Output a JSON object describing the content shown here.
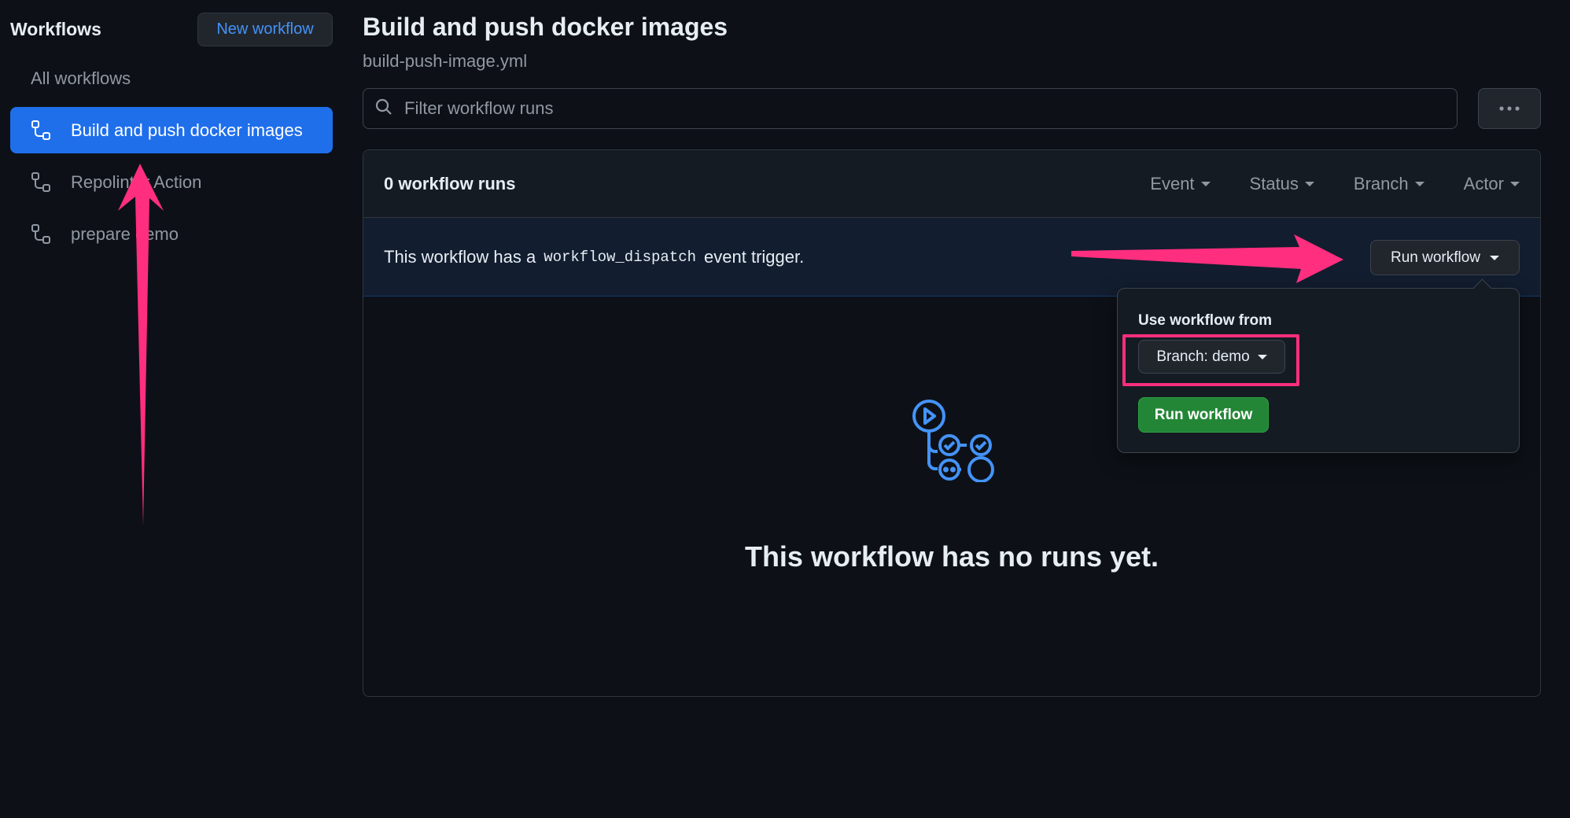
{
  "sidebar": {
    "title": "Workflows",
    "new_workflow_label": "New workflow",
    "all_workflows_label": "All workflows",
    "items": [
      {
        "label": "Build and push docker images",
        "active": true
      },
      {
        "label": "Repolinter Action",
        "active": false
      },
      {
        "label": "prepare demo",
        "active": false
      }
    ]
  },
  "main": {
    "title": "Build and push docker images",
    "file_name": "build-push-image.yml",
    "filter": {
      "placeholder": "Filter workflow runs",
      "value": ""
    },
    "runs_count": "0 workflow runs",
    "filter_menus": [
      "Event",
      "Status",
      "Branch",
      "Actor"
    ],
    "dispatch": {
      "prefix": "This workflow has a",
      "code": "workflow_dispatch",
      "suffix": "event trigger."
    },
    "run_workflow_button": "Run workflow",
    "empty_text": "This workflow has no runs yet."
  },
  "popover": {
    "label": "Use workflow from",
    "branch_button": "Branch: demo",
    "run_button": "Run workflow"
  },
  "colors": {
    "background": "#0d1117",
    "accent_blue": "#1f6feb",
    "link_blue": "#4493f8",
    "green": "#238636",
    "annotation_pink": "#ff2e7e"
  }
}
